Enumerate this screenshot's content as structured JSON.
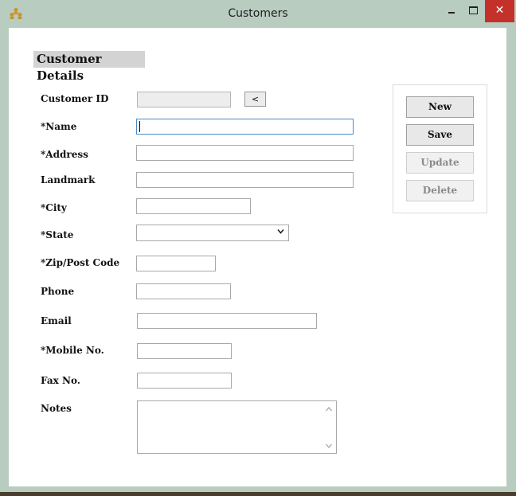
{
  "window": {
    "title": "Customers",
    "close_glyph": "✕"
  },
  "section_title": "Customer Details",
  "fields": {
    "customer_id": {
      "label": "Customer ID",
      "value": ""
    },
    "lookup_button": "<",
    "name": {
      "label": "*Name",
      "value": ""
    },
    "address": {
      "label": "*Address",
      "value": ""
    },
    "landmark": {
      "label": "Landmark",
      "value": ""
    },
    "city": {
      "label": "*City",
      "value": ""
    },
    "state": {
      "label": "*State",
      "selected": ""
    },
    "zip": {
      "label": "*Zip/Post Code",
      "value": ""
    },
    "phone": {
      "label": "Phone",
      "value": ""
    },
    "email": {
      "label": "Email",
      "value": ""
    },
    "mobile": {
      "label": "*Mobile No.",
      "value": ""
    },
    "fax": {
      "label": "Fax No.",
      "value": ""
    },
    "notes": {
      "label": "Notes",
      "value": ""
    }
  },
  "actions": {
    "new": "New",
    "save": "Save",
    "update": "Update",
    "delete": "Delete"
  },
  "icons": {
    "app": "people-group-icon",
    "state_dropdown": "chevron-down-icon",
    "scroll_up": "scroll-up-arrow-icon",
    "scroll_down": "scroll-down-arrow-icon"
  },
  "colors": {
    "title_bar": "#b9ccc0",
    "close_button": "#c4312b",
    "section_title_bg": "#d3d3d3",
    "focus_border": "#4a8bc6"
  }
}
